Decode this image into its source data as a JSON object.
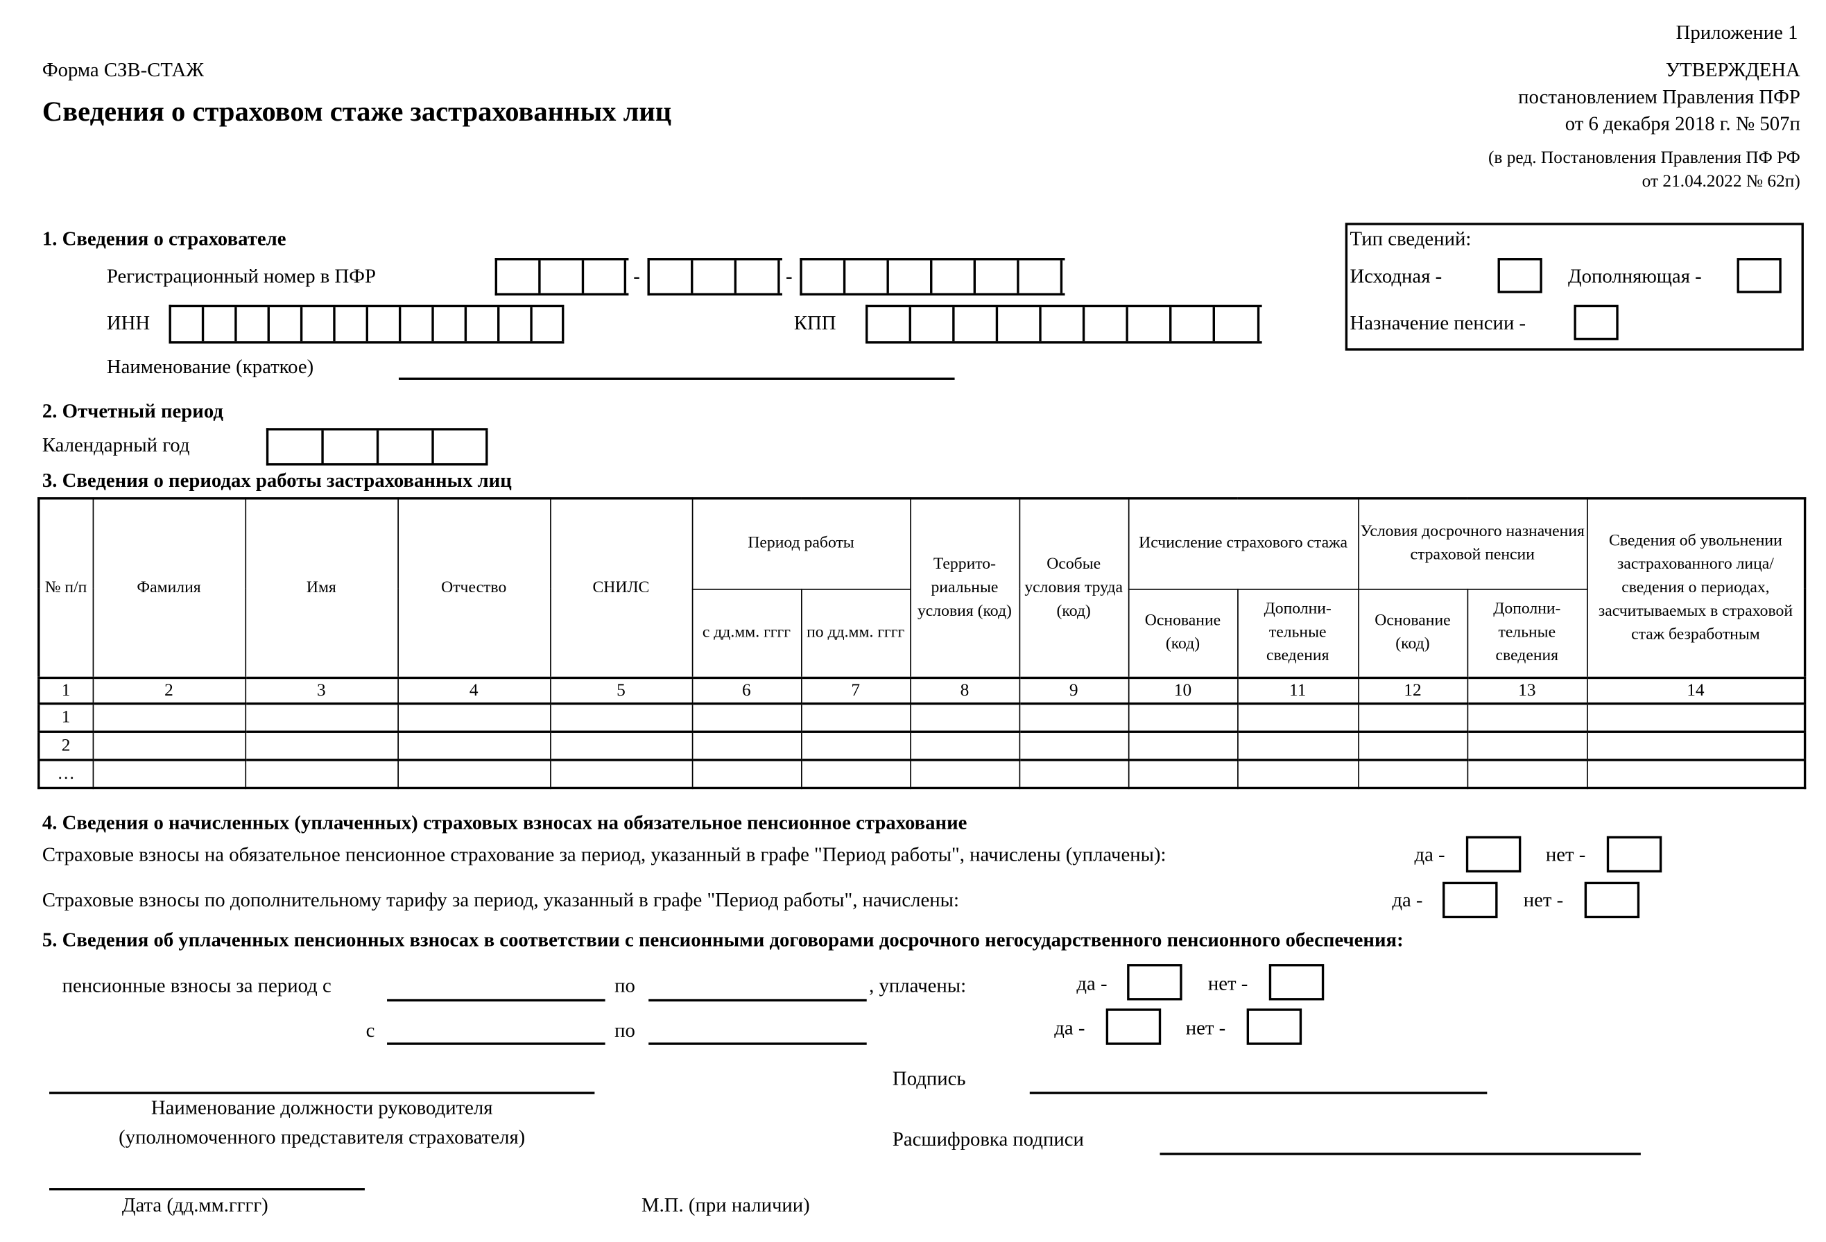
{
  "header": {
    "appendix": "Приложение 1",
    "form_name": "Форма СЗВ-СТАЖ",
    "title": "Сведения о страховом стаже застрахованных лиц",
    "approved": "УТВЕРЖДЕНА",
    "approved_by": "постановлением Правления ПФР",
    "approved_date": "от 6 декабря 2018 г. № 507п",
    "revision_1": "(в ред. Постановления Правления ПФ РФ",
    "revision_2": "от 21.04.2022 № 62п)"
  },
  "section1": {
    "heading": "1. Сведения о страхователе",
    "reg_number_label": "Регистрационный номер в ПФР",
    "separator": "-",
    "inn_label": "ИНН",
    "kpp_label": "КПП",
    "name_label": "Наименование (краткое)",
    "reg_number_value": "",
    "inn_value": "",
    "kpp_value": "",
    "name_value": ""
  },
  "info_type": {
    "heading": "Тип сведений:",
    "original_label": "Исходная -",
    "supplementary_label": "Дополняющая -",
    "pension_label": "Назначение пенсии -"
  },
  "section2": {
    "heading": "2. Отчетный период",
    "year_label": "Календарный год",
    "year_value": ""
  },
  "section3": {
    "heading": "3. Сведения о периодах работы застрахованных лиц",
    "columns": {
      "num": "№ п/п",
      "surname": "Фамилия",
      "name": "Имя",
      "patronymic": "Отчество",
      "snils": "СНИЛС",
      "period": "Период работы",
      "from": "с дд.мм. гггг",
      "to": "по дд.мм. гггг",
      "territorial": "Террито-риальные условия (код)",
      "special": "Особые условия труда (код)",
      "calc": "Исчисление страхового стажа",
      "calc_basis": "Основание (код)",
      "calc_extra": "Дополни-тельные сведения",
      "early": "Условия досрочного назначения страховой пенсии",
      "early_basis": "Основание (код)",
      "early_extra": "Дополни-тельные сведения",
      "dismissal": "Сведения об увольнении застрахованного лица/ сведения о периодах, засчитываемых в страховой стаж безработным"
    },
    "column_numbers": [
      "1",
      "2",
      "3",
      "4",
      "5",
      "6",
      "7",
      "8",
      "9",
      "10",
      "11",
      "12",
      "13",
      "14"
    ],
    "rows": [
      {
        "num": "1"
      },
      {
        "num": "2"
      },
      {
        "num": "…"
      }
    ]
  },
  "section4": {
    "heading": "4. Сведения о начисленных (уплаченных) страховых взносах на обязательное пенсионное страхование",
    "line1": "Страховые взносы на обязательное пенсионное страхование за период, указанный в графе \"Период работы\", начислены (уплачены):",
    "line2": "Страховые взносы по дополнительному тарифу за период, указанный в графе \"Период работы\", начислены:",
    "yes": "да -",
    "no": "нет -"
  },
  "section5": {
    "heading": "5. Сведения об уплаченных пенсионных взносах в соответствии с пенсионными договорами досрочного негосударственного пенсионного обеспечения:",
    "period_label": "пенсионные взносы за период с",
    "from_label": "с",
    "to_label": "по",
    "paid_label": ", уплачены:",
    "yes": "да -",
    "no": "нет -"
  },
  "signature": {
    "position_label_1": "Наименование должности руководителя",
    "position_label_2": "(уполномоченного представителя страхователя)",
    "signature_label": "Подпись",
    "decode_label": "Расшифровка подписи",
    "date_label": "Дата (дд.мм.гггг)",
    "stamp_label": "М.П. (при наличии)"
  }
}
